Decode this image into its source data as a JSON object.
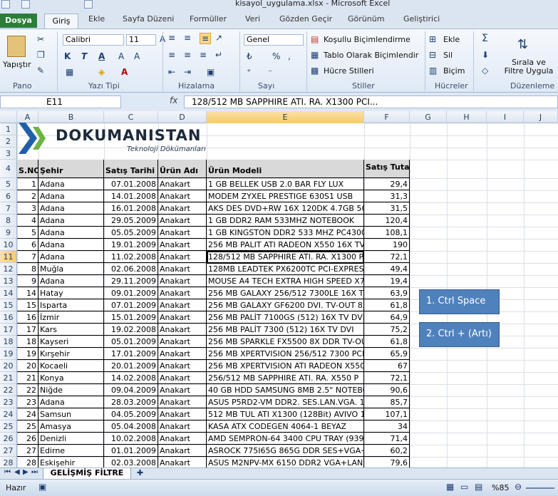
{
  "window": {
    "title": "kisayol_uygulama.xlsx  -  Microsoft Excel"
  },
  "tabs": [
    "Dosya",
    "Giriş",
    "Ekle",
    "Sayfa Düzeni",
    "Formüller",
    "Veri",
    "Gözden Geçir",
    "Görünüm",
    "Geliştirici"
  ],
  "ribbon": {
    "groups": [
      "Pano",
      "Yazı Tipi",
      "Hizalama",
      "Sayı",
      "Stiller",
      "Hücreler",
      "Düzenleme"
    ],
    "paste_label": "Yapıştır",
    "font_name": "Calibri",
    "font_size": "11",
    "number_format": "Genel",
    "styles": [
      "Koşullu Biçimlendirme",
      "Tablo Olarak Biçimlendir",
      "Hücre Stilleri"
    ],
    "cells": [
      "Ekle",
      "Sil",
      "Biçim"
    ],
    "sort_filter": "Sırala ve Filtre Uygula"
  },
  "formula_bar": {
    "name_box": "E11",
    "fx": "fx",
    "content": "128/512 MB SAPPHIRE ATI. RA. X1300 PCI..."
  },
  "columns": [
    "A",
    "B",
    "C",
    "D",
    "E",
    "F",
    "G",
    "H",
    "I",
    "J"
  ],
  "logo": {
    "brand": "DOKUMANISTAN",
    "subtitle": "Teknoloji Dökümanları"
  },
  "table": {
    "headers": [
      "S.NO",
      "Şehir",
      "Satış Tarihi",
      "Ürün Adı",
      "Ürün Modeli",
      "Satış Tutarı"
    ],
    "rows": [
      [
        "1",
        "Adana",
        "07.01.2008",
        "Anakart",
        "1 GB BELLEK USB 2.0 BAR FLY LUX",
        "29,4"
      ],
      [
        "2",
        "Adana",
        "14.01.2008",
        "Anakart",
        "MODEM ZYXEL PRESTIGE 630S1 USB",
        "31,3"
      ],
      [
        "3",
        "Adana",
        "16.01.2008",
        "Anakart",
        "AKS DES DVD+RW 16X 120DK 4.7GB 50Lİ C",
        "31,5"
      ],
      [
        "4",
        "Adana",
        "29.05.2009",
        "Anakart",
        "1 GB DDR2 RAM 533MHZ NOTEBOOK",
        "120,4"
      ],
      [
        "5",
        "Adana",
        "05.05.2009",
        "Anakart",
        "1 GB KINGSTON DDR2 533 MHZ PC4300 NC",
        "108,1"
      ],
      [
        "6",
        "Adana",
        "19.01.2009",
        "Anakart",
        "256 MB PALIT ATI RADEON X550 16X TV DV",
        "190"
      ],
      [
        "7",
        "Adana",
        "11.02.2008",
        "Anakart",
        "128/512 MB SAPPHIRE ATI. RA. X1300 PCI...",
        "72,1"
      ],
      [
        "8",
        "Muğla",
        "02.06.2008",
        "Anakart",
        "128MB LEADTEK PX6200TC PCI-EXPRES",
        "49,4"
      ],
      [
        "9",
        "Adana",
        "29.11.2009",
        "Anakart",
        "MOUSE A4 TECH EXTRA HIGH SPEED X708 F",
        "19,4"
      ],
      [
        "14",
        "Hatay",
        "09.01.2009",
        "Anakart",
        "256 MB GALAXY 256/512 7300LE 16X TV-OU",
        "63,9"
      ],
      [
        "15",
        "Isparta",
        "07.01.2009",
        "Anakart",
        "256 MB GALAXY GF6200 DVI. TV-OUT 8XAG",
        "61,8"
      ],
      [
        "16",
        "İzmir",
        "15.01.2009",
        "Anakart",
        "256 MB PALİT 7100GS (512) 16X TV DVI",
        "64,9"
      ],
      [
        "17",
        "Kars",
        "19.02.2008",
        "Anakart",
        "256 MB PALİT 7300 (512) 16X TV DVI",
        "75,2"
      ],
      [
        "18",
        "Kayseri",
        "05.01.2009",
        "Anakart",
        "256 MB SPARKLE FX5500 8X DDR TV-OUT",
        "61,8"
      ],
      [
        "19",
        "Kırşehir",
        "17.01.2009",
        "Anakart",
        "256 MB XPERTVISION 256/512 7300 PCI.EX",
        "65,9"
      ],
      [
        "20",
        "Kocaeli",
        "20.01.2009",
        "Anakart",
        "256 MB XPERTVISION ATI RADEON X550 PC",
        "67"
      ],
      [
        "21",
        "Konya",
        "14.02.2008",
        "Anakart",
        "256/512 MB SAPPHIRE ATI. RA. X550 P",
        "72,1"
      ],
      [
        "22",
        "Niğde",
        "09.04.2009",
        "Anakart",
        "40 GB HDD SAMSUNG 8MB 2.5\" NOTEBOOK",
        "90,6"
      ],
      [
        "23",
        "Adana",
        "28.03.2009",
        "Anakart",
        "ASUS P5RD2-VM DDR2. SES.LAN.VGA. 16X.",
        "85,7"
      ],
      [
        "24",
        "Samsun",
        "04.05.2009",
        "Anakart",
        "512 MB TUL ATI X1300 (128Bit) AVIVO 16.",
        "107,1"
      ],
      [
        "25",
        "Amasya",
        "05.04.2008",
        "Anakart",
        "KASA ATX CODEGEN 4064-1 BEYAZ",
        "34"
      ],
      [
        "26",
        "Denizli",
        "10.02.2008",
        "Anakart",
        "AMD SEMPRON-64 3400 CPU TRAY (939)",
        "71,4"
      ],
      [
        "27",
        "Edirne",
        "01.01.2009",
        "Anakart",
        "ASROCK 775I65G 865G DDR SES+VGA+LAN-",
        "60,2"
      ],
      [
        "28",
        "Eskişehir",
        "02.03.2008",
        "Anakart",
        "ASUS M2NPV-MX 6150 DDR2 VGA+LAN+SAT",
        "79,6"
      ]
    ]
  },
  "callouts": [
    "1. Ctrl  Space",
    "2. Ctrl  + (Artı)"
  ],
  "sheet_tab": "GELİŞMİŞ FİLTRE",
  "status": {
    "ready": "Hazır",
    "zoom": "%85"
  }
}
